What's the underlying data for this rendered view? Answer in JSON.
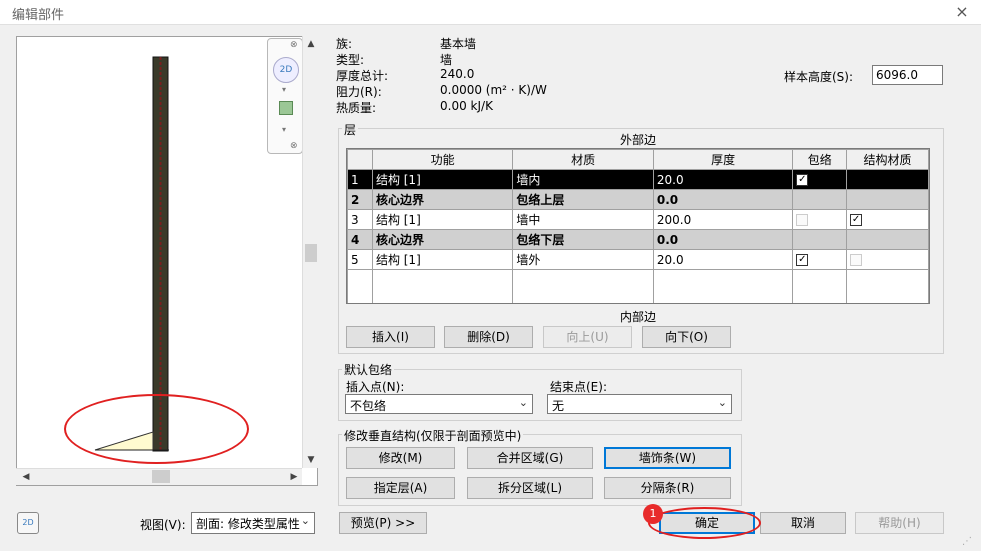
{
  "window": {
    "title": "编辑部件",
    "close": "×"
  },
  "properties": [
    {
      "label": "族:",
      "value": "基本墙"
    },
    {
      "label": "类型:",
      "value": "墙"
    },
    {
      "label": "厚度总计:",
      "value": "240.0"
    },
    {
      "label": "阻力(R):",
      "value": "0.0000 (m² · K)/W"
    },
    {
      "label": "热质量:",
      "value": "0.00 kJ/K"
    }
  ],
  "sample_height": {
    "label": "样本高度(S):",
    "value": "6096.0"
  },
  "layers": {
    "group_title": "层",
    "exterior_label": "外部边",
    "interior_label": "内部边",
    "columns": [
      "功能",
      "材质",
      "厚度",
      "包络",
      "结构材质"
    ],
    "rows": [
      {
        "num": "1",
        "function": "结构 [1]",
        "material": "墙内",
        "thickness": "20.0"
      },
      {
        "num": "2",
        "function": "核心边界",
        "material": "包络上层",
        "thickness": "0.0"
      },
      {
        "num": "3",
        "function": "结构 [1]",
        "material": "墙中",
        "thickness": "200.0"
      },
      {
        "num": "4",
        "function": "核心边界",
        "material": "包络下层",
        "thickness": "0.0"
      },
      {
        "num": "5",
        "function": "结构 [1]",
        "material": "墙外",
        "thickness": "20.0"
      }
    ],
    "buttons": {
      "insert": "插入(I)",
      "delete": "删除(D)",
      "up": "向上(U)",
      "down": "向下(O)"
    }
  },
  "wrapping": {
    "title": "默认包络",
    "insert_label": "插入点(N):",
    "insert_value": "不包络",
    "end_label": "结束点(E):",
    "end_value": "无"
  },
  "vertical": {
    "title": "修改垂直结构(仅限于剖面预览中)",
    "buttons": {
      "modify": "修改(M)",
      "merge": "合并区域(G)",
      "sweep": "墙饰条(W)",
      "assign": "指定层(A)",
      "split": "拆分区域(L)",
      "reveal": "分隔条(R)"
    }
  },
  "bottom": {
    "view_label": "视图(V):",
    "view_value": "剖面: 修改类型属性",
    "preview": "预览(P) >>",
    "ok": "确定",
    "cancel": "取消",
    "help": "帮助(H)",
    "badge": "1"
  },
  "icons": {
    "nav2d": "2D",
    "zoom": "⌕"
  },
  "colors": {
    "accent": "#0078d7",
    "annotation": "#e02020",
    "wall_line": "#7a1f1f"
  }
}
